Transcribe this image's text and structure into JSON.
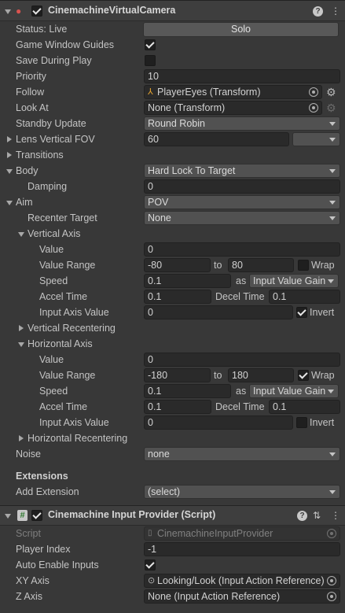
{
  "vcam": {
    "title": "CinemachineVirtualCamera",
    "status_label": "Status: Live",
    "solo_label": "Solo",
    "game_window_guides_label": "Game Window Guides",
    "game_window_guides": true,
    "save_during_play_label": "Save During Play",
    "save_during_play": false,
    "priority_label": "Priority",
    "priority": "10",
    "follow_label": "Follow",
    "follow": "PlayerEyes (Transform)",
    "look_at_label": "Look At",
    "look_at": "None (Transform)",
    "standby_update_label": "Standby Update",
    "standby_update": "Round Robin",
    "lens_fov_label": "Lens Vertical FOV",
    "lens_fov": "60",
    "transitions_label": "Transitions",
    "body_label": "Body",
    "body": "Hard Lock To Target",
    "damping_label": "Damping",
    "damping": "0",
    "aim_label": "Aim",
    "aim": "POV",
    "recenter_target_label": "Recenter Target",
    "recenter_target": "None",
    "vertical_axis": {
      "label": "Vertical Axis",
      "value_label": "Value",
      "value": "0",
      "range_label": "Value Range",
      "range_min": "-80",
      "to_label": "to",
      "range_max": "80",
      "wrap_label": "Wrap",
      "wrap": false,
      "speed_label": "Speed",
      "speed": "0.1",
      "as_label": "as",
      "speed_mode": "Input Value Gain",
      "accel_label": "Accel Time",
      "accel": "0.1",
      "decel_label": "Decel Time",
      "decel": "0.1",
      "input_label": "Input Axis Value",
      "input": "0",
      "invert_label": "Invert",
      "invert": true
    },
    "vertical_recentering_label": "Vertical Recentering",
    "horizontal_axis": {
      "label": "Horizontal Axis",
      "value_label": "Value",
      "value": "0",
      "range_label": "Value Range",
      "range_min": "-180",
      "to_label": "to",
      "range_max": "180",
      "wrap_label": "Wrap",
      "wrap": true,
      "speed_label": "Speed",
      "speed": "0.1",
      "as_label": "as",
      "speed_mode": "Input Value Gain",
      "accel_label": "Accel Time",
      "accel": "0.1",
      "decel_label": "Decel Time",
      "decel": "0.1",
      "input_label": "Input Axis Value",
      "input": "0",
      "invert_label": "Invert",
      "invert": false
    },
    "horizontal_recentering_label": "Horizontal Recentering",
    "noise_label": "Noise",
    "noise": "none",
    "extensions_label": "Extensions",
    "add_extension_label": "Add Extension",
    "add_extension": "(select)"
  },
  "input_provider": {
    "title": "Cinemachine Input Provider (Script)",
    "script_label": "Script",
    "script": "CinemachineInputProvider",
    "player_index_label": "Player Index",
    "player_index": "-1",
    "auto_enable_label": "Auto Enable Inputs",
    "auto_enable": true,
    "xy_axis_label": "XY Axis",
    "xy_axis": "Looking/Look (Input Action Reference)",
    "z_axis_label": "Z Axis",
    "z_axis": "None (Input Action Reference)"
  },
  "icons": {
    "component_icon": "camera-icon",
    "script_icon": "hash-icon",
    "help": "help-icon",
    "presets": "sliders-icon",
    "menu": "kebab-menu-icon",
    "settings": "gear-icon"
  }
}
